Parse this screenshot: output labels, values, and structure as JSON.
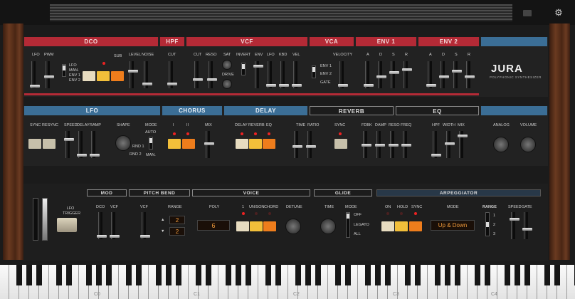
{
  "brand": {
    "name": "JURA",
    "subtitle": "POLYPHONIC SYNTHESIZER"
  },
  "icons": {
    "settings": "gear-icon",
    "folder": "folder-icon"
  },
  "row1": {
    "dco": "DCO",
    "hpf": "HPF",
    "vcf": "VCF",
    "vca": "VCA",
    "env1": "ENV 1",
    "env2": "ENV 2",
    "dco_labels": {
      "lfo": "LFO",
      "pwm": "PWM",
      "lfo_src": "LFO",
      "man": "MAN.",
      "env1": "ENV 1",
      "env2": "ENV 2",
      "sub": "SUB",
      "sub_sym": "╨",
      "level": "LEVEL",
      "noise": "NOISE"
    },
    "hpf_labels": {
      "cut": "CUT"
    },
    "vcf_labels": {
      "cut": "CUT",
      "reso": "RESO",
      "sat": "SAT",
      "drive": "DRIVE",
      "invert": "INVERT",
      "env": "ENV",
      "lfo": "LFO",
      "kbd": "KBD",
      "vel": "VEL"
    },
    "vca_labels": {
      "velocity": "VELOCITY",
      "env1": "ENV 1",
      "env2": "ENV 2",
      "gate": "GATE"
    },
    "adsr": [
      "A",
      "D",
      "S",
      "R"
    ]
  },
  "row2": {
    "lfo": "LFO",
    "chorus": "CHORUS",
    "delay": "DELAY",
    "reverb": "REVERB",
    "eq": "EQ",
    "lfo_labels": {
      "sync": "SYNC",
      "resync": "RESYNC",
      "speed": "SPEED",
      "delay": "DELAY",
      "ramp": "RAMP",
      "shape": "SHAPE",
      "mode": "MODE",
      "auto": "AUTO",
      "man": "MAN.",
      "rnd1": "RND 1",
      "rnd2": "RND 2"
    },
    "chorus_labels": {
      "i": "I",
      "ii": "II",
      "mix": "MIX"
    },
    "delay_labels": {
      "delay": "DELAY",
      "reverb": "REVERB",
      "eq": "EQ",
      "time": "TIME",
      "ratio": "RATIO",
      "sync": "SYNC"
    },
    "reverb_labels": {
      "fdbk": "FDBK",
      "damp": "DAMP",
      "reso": "RESO",
      "freq": "FREQ"
    },
    "eq_labels": {
      "hpf": "HPF",
      "width": "WIDTH",
      "mix": "MIX"
    },
    "analog": "ANALOG",
    "volume": "VOLUME"
  },
  "row3": {
    "lfo_trigger": "LFO TRIGGER",
    "mod": "MOD",
    "dco": "DCO",
    "vcf": "VCF",
    "pitch_bend": "PITCH BEND",
    "pb_vcf": "VCF",
    "range": "RANGE",
    "range_up": "2",
    "range_down": "2",
    "voice": "VOICE",
    "poly": "POLY",
    "poly_value": "6",
    "v_1": "1",
    "unison": "UNISON",
    "chord": "CHORD",
    "detune": "DETUNE",
    "glide": "GLIDE",
    "time": "TIME",
    "mode": "MODE",
    "off": "OFF",
    "legato": "LEGATO",
    "all": "ALL",
    "arpeggiator": "ARPEGGIATOR",
    "on": "ON",
    "hold": "HOLD",
    "sync": "SYNC",
    "arp_mode": "MODE",
    "arp_mode_value": "Up & Down",
    "arp_range": "RANGE",
    "r1": "1",
    "r2": "2",
    "r3": "3",
    "speed": "SPEED",
    "gate": "GATE"
  },
  "keyboard": {
    "labels": [
      "C0",
      "C1",
      "C2",
      "C3",
      "C4"
    ]
  }
}
